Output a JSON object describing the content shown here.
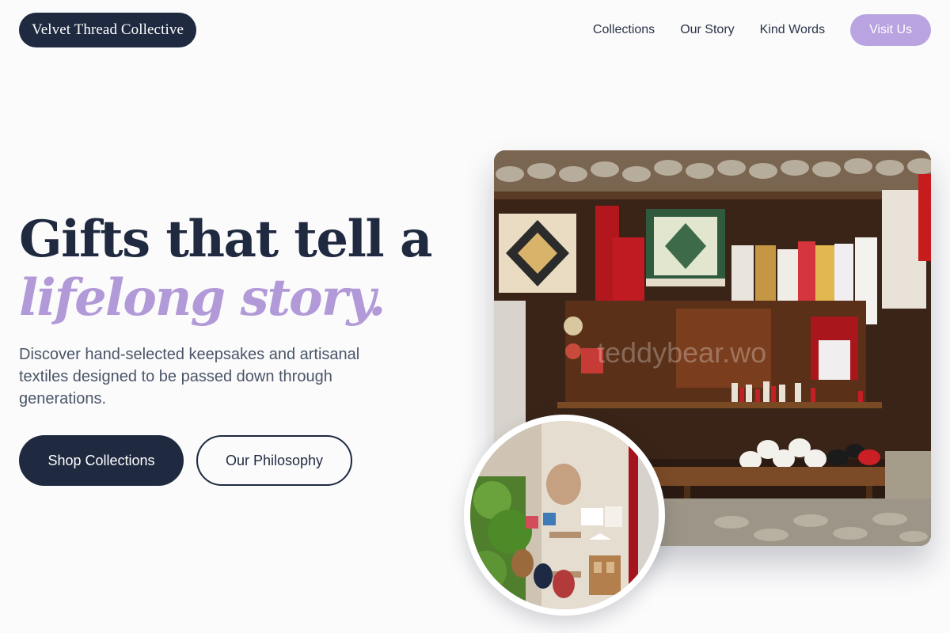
{
  "header": {
    "brand": "Velvet Thread Collective",
    "nav": {
      "collections": "Collections",
      "story": "Our Story",
      "kind_words": "Kind Words"
    },
    "cta": "Visit Us"
  },
  "hero": {
    "title_line1": "Gifts that tell a",
    "title_line2": "lifelong story.",
    "subtitle": "Discover hand-selected keepsakes and artisanal textiles designed to be passed down through generations.",
    "primary_button": "Shop Collections",
    "secondary_button": "Our Philosophy"
  },
  "colors": {
    "navy": "#1f2a40",
    "lavender": "#b9a3e0",
    "accent_text": "#b29ad8"
  },
  "images": {
    "main_watermark": "teddybear.wo"
  }
}
